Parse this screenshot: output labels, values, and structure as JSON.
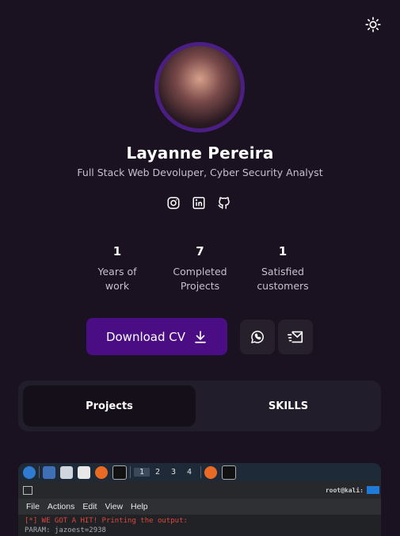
{
  "profile": {
    "name": "Layanne Pereira",
    "subtitle": "Full Stack Web Devoluper, Cyber Security Analyst"
  },
  "icons": {
    "theme": "sun-icon",
    "socials": [
      "instagram-icon",
      "linkedin-icon",
      "github-icon"
    ],
    "download": "download-icon",
    "whatsapp": "whatsapp-icon",
    "mail": "mail-send-icon"
  },
  "stats": [
    {
      "value": "1",
      "label_line1": "Years of",
      "label_line2": "work"
    },
    {
      "value": "7",
      "label_line1": "Completed",
      "label_line2": "Projects"
    },
    {
      "value": "1",
      "label_line1": "Satisfied",
      "label_line2": "customers"
    }
  ],
  "actions": {
    "download_label": "Download CV"
  },
  "tabs": [
    {
      "label": "Projects",
      "active": true
    },
    {
      "label": "SKILLS",
      "active": false
    }
  ],
  "project_preview": {
    "workspaces": [
      "1",
      "2",
      "3",
      "4"
    ],
    "titlebar_user": "root@kali:",
    "menu": [
      "File",
      "Actions",
      "Edit",
      "View",
      "Help"
    ],
    "lines": [
      "[*] WE GOT A HIT! Printing the output:",
      "PARAM: jazoest=2938"
    ]
  },
  "colors": {
    "background": "#1a1221",
    "accent": "#4a0d84",
    "card": "#221d2a"
  }
}
